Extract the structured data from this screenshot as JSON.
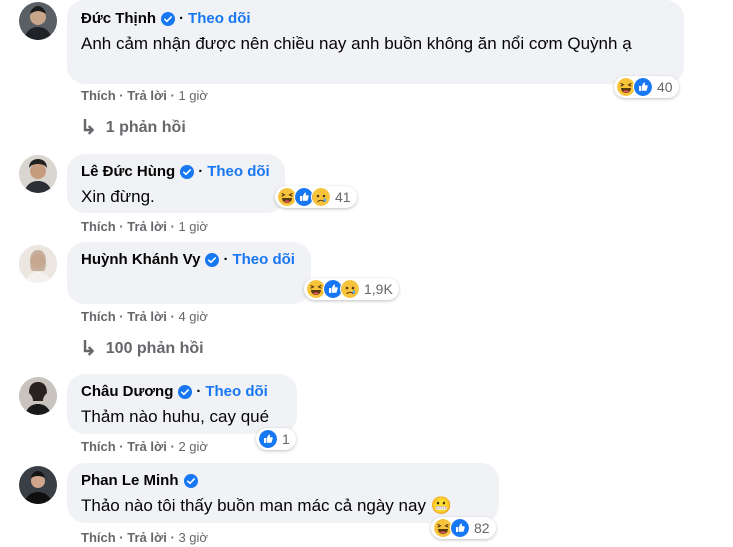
{
  "labels": {
    "follow": "Theo dõi",
    "like": "Thích",
    "reply": "Trả lời",
    "dot": "·"
  },
  "comments": [
    {
      "name": "Đức Thịnh",
      "text": "Anh cảm nhận được nên chiều nay anh buồn không ăn nổi cơm Quỳnh ạ",
      "reaction_count": "40",
      "reactions": [
        "haha-icon",
        "like-icon"
      ],
      "time": "1 giờ"
    },
    {
      "name": "Lê Đức Hùng",
      "text": "Xin đừng.",
      "reaction_count": "41",
      "reactions": [
        "haha-icon",
        "like-icon",
        "sad-icon"
      ],
      "time": "1 giờ"
    },
    {
      "name": "Huỳnh Khánh Vy",
      "text": "",
      "reaction_count": "1,9K",
      "reactions": [
        "haha-icon",
        "like-icon",
        "sad-icon"
      ],
      "time": "4 giờ"
    },
    {
      "name": "Châu Dương",
      "text": "Thảm nào huhu, cay qué",
      "reaction_count": "1",
      "reactions": [
        "like-icon"
      ],
      "time": "2 giờ"
    },
    {
      "name": "Phan Le Minh",
      "text": "Thảo nào tôi thấy buồn man mác cả ngày nay",
      "text_emoji": "😬",
      "reaction_count": "82",
      "reactions": [
        "haha-icon",
        "like-icon"
      ],
      "time": "3 giờ"
    }
  ],
  "replies": [
    {
      "label": "1 phản hồi"
    },
    {
      "label": "100 phản hồi"
    }
  ],
  "colors": {
    "bubble": "#f0f2f5",
    "accent": "#1877f2",
    "meta": "#65676b"
  }
}
